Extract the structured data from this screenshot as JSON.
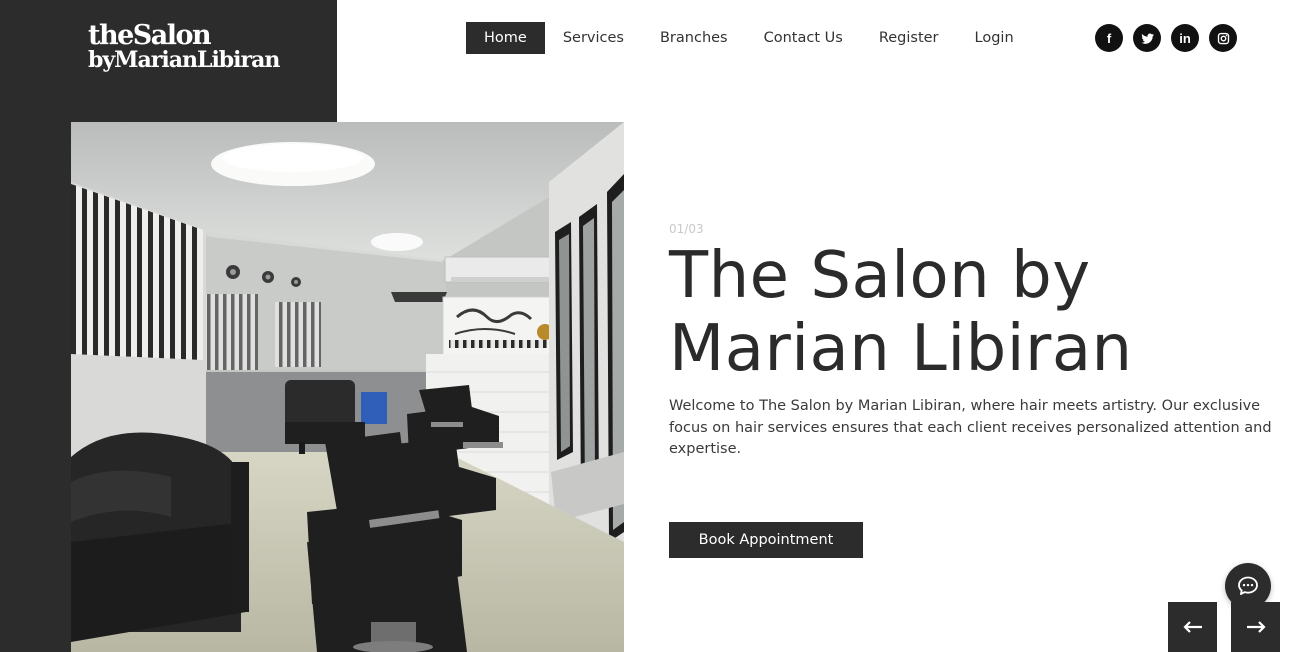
{
  "logo": {
    "line1": "theSalon",
    "line2": "byMarianLibiran"
  },
  "nav": {
    "items": [
      {
        "label": "Home",
        "active": true
      },
      {
        "label": "Services"
      },
      {
        "label": "Branches"
      },
      {
        "label": "Contact Us"
      },
      {
        "label": "Register"
      },
      {
        "label": "Login"
      }
    ]
  },
  "social": {
    "icons": [
      "facebook-icon",
      "twitter-icon",
      "linkedin-icon",
      "instagram-icon"
    ],
    "facebook_glyph": "f",
    "linkedin_glyph": "in"
  },
  "hero": {
    "counter": "01/03",
    "title_line1": "The Salon by",
    "title_line2": "Marian Libiran",
    "description": "Welcome to The Salon by Marian Libiran, where hair meets artistry. Our exclusive focus on hair services ensures that each client receives personalized attention and expertise.",
    "button_label": "Book Appointment"
  },
  "controls": {
    "chat_icon": "chat-bubble-icon",
    "prev_icon": "arrow-left-icon",
    "next_icon": "arrow-right-icon"
  },
  "colors": {
    "dark": "#2c2c2c",
    "text": "#2b2b2b",
    "background": "#ffffff",
    "counter": "#c9c9c9"
  }
}
